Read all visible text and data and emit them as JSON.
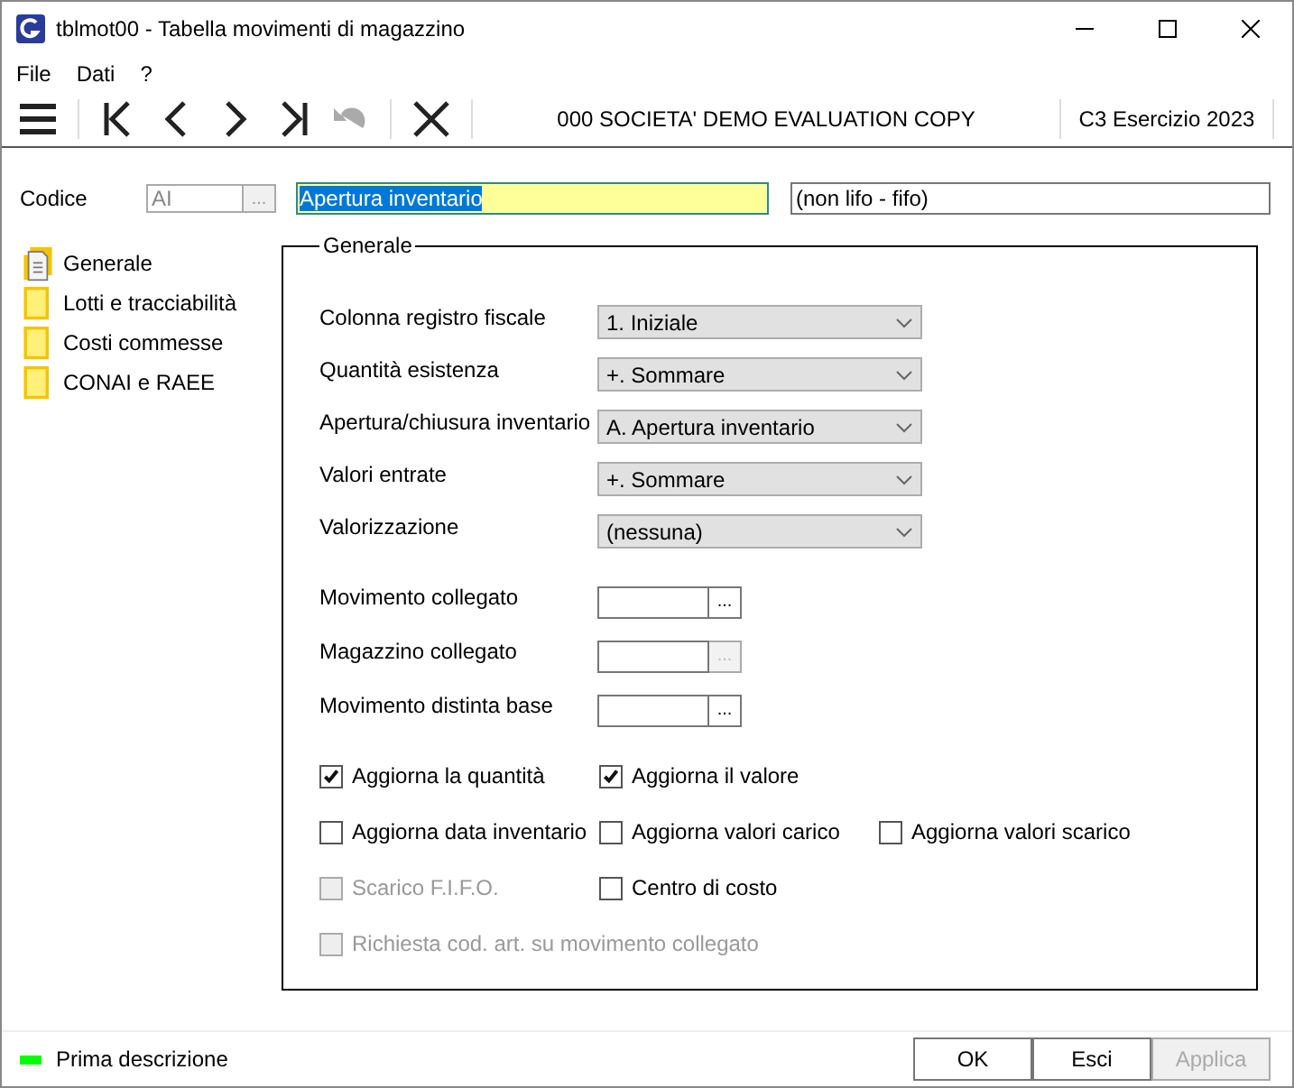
{
  "window": {
    "title": "tblmot00 - Tabella movimenti di magazzino"
  },
  "menu": [
    "File",
    "Dati",
    "?"
  ],
  "toolbar": {
    "company": "000 SOCIETA'  DEMO EVALUATION COPY",
    "year": "C3 Esercizio 2023"
  },
  "header": {
    "label": "Codice",
    "code": "AI",
    "lookup": "...",
    "description": "Apertura inventario",
    "note": "(non lifo - fifo)"
  },
  "sidebar": {
    "items": [
      {
        "label": "Generale",
        "selected": true
      },
      {
        "label": "Lotti e tracciabilità",
        "selected": false
      },
      {
        "label": "Costi commesse",
        "selected": false
      },
      {
        "label": "CONAI e RAEE",
        "selected": false
      }
    ]
  },
  "group": {
    "title": "Generale",
    "selects": [
      {
        "label": "Colonna registro fiscale",
        "value": "1. Iniziale"
      },
      {
        "label": "Quantità esistenza",
        "value": "+. Sommare"
      },
      {
        "label": "Apertura/chiusura inventario",
        "value": "A. Apertura inventario"
      },
      {
        "label": "Valori entrate",
        "value": "+. Sommare"
      },
      {
        "label": "Valorizzazione",
        "value": "(nessuna)"
      }
    ],
    "lookups": [
      {
        "label": "Movimento collegato",
        "button": "...",
        "disabled": false
      },
      {
        "label": "Magazzino collegato",
        "button": "...",
        "disabled": true
      },
      {
        "label": "Movimento distinta base",
        "button": "...",
        "disabled": false
      }
    ],
    "checkbox_rows": [
      [
        {
          "label": "Aggiorna la quantità",
          "checked": true,
          "disabled": false
        },
        {
          "label": "Aggiorna il valore",
          "checked": true,
          "disabled": false
        }
      ],
      [
        {
          "label": "Aggiorna data inventario",
          "checked": false,
          "disabled": false
        },
        {
          "label": "Aggiorna valori carico",
          "checked": false,
          "disabled": false
        },
        {
          "label": "Aggiorna valori scarico",
          "checked": false,
          "disabled": false
        }
      ],
      [
        {
          "label": "Scarico F.I.F.O.",
          "checked": false,
          "disabled": true
        },
        {
          "label": "Centro di costo",
          "checked": false,
          "disabled": false
        }
      ],
      [
        {
          "label": "Richiesta cod. art. su movimento collegato",
          "checked": false,
          "disabled": true
        }
      ]
    ]
  },
  "status_bar": {
    "text": "Prima descrizione"
  },
  "buttons": [
    {
      "label": "OK",
      "disabled": false
    },
    {
      "label": "Esci",
      "disabled": false
    },
    {
      "label": "Applica",
      "disabled": true
    }
  ]
}
